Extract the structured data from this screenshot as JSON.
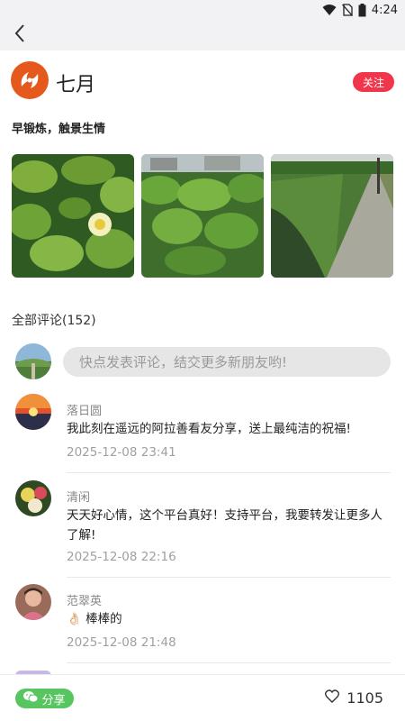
{
  "status_bar": {
    "time": "4:24",
    "icons": [
      "wifi-icon",
      "no-sim-icon",
      "battery-icon"
    ]
  },
  "nav": {
    "back_icon": "chevron-left-icon"
  },
  "author": {
    "name": "七月",
    "follow_label": "关注",
    "follow_color": "#f0364a",
    "logo_color": "#e55a1c"
  },
  "post": {
    "text": "早锻炼，触景生情",
    "photos": [
      "lotus-flower-photo",
      "lotus-pond-photo",
      "lakeside-path-photo"
    ]
  },
  "comments_section": {
    "title": "全部评论(152)",
    "input_placeholder": "快点发表评论，结交更多新朋友哟!",
    "items": [
      {
        "name": "落日圆",
        "text": "我此刻在遥远的阿拉善看友分享，送上最纯洁的祝福!",
        "time": "2025-12-08 23:41"
      },
      {
        "name": "清闲",
        "text": "天天好心情，这个平台真好！支持平台，我要转发让更多人了解!",
        "time": "2025-12-08 22:16"
      },
      {
        "name": "范翠英",
        "text": "👌🏻 棒棒的",
        "time": "2025-12-08 21:48"
      }
    ]
  },
  "bottom_bar": {
    "share_label": "分享",
    "share_color": "#58c660",
    "like_count": "1105"
  }
}
